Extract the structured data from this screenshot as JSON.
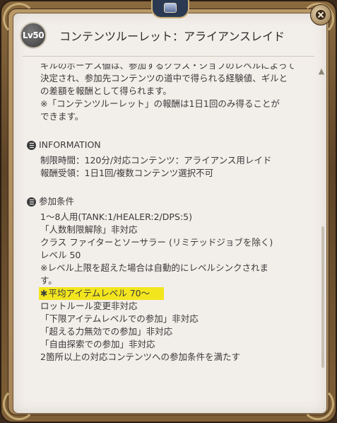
{
  "header": {
    "level_badge": "Lv50",
    "title": "コンテンツルーレット：アライアンスレイド"
  },
  "intro_lines": [
    "ギルのボーナス値は、参加するクラス・ジョブのレベルによって",
    "決定され、参加先コンテンツの道中で得られる経験値、ギルと",
    "の差額を報酬として得られます。",
    "※「コンテンツルーレット」の報酬は1日1回のみ得ることが",
    "できます。"
  ],
  "information": {
    "heading": "INFORMATION",
    "lines": [
      "制限時間：120分/対応コンテンツ：アライアンス用レイド",
      "報酬受領：1日1回/複数コンテンツ選択不可"
    ]
  },
  "conditions": {
    "heading": "参加条件",
    "lines_before": [
      "1〜8人用(TANK:1/HEALER:2/DPS:5)",
      "「人数制限解除」非対応",
      "クラス ファイターとソーサラー (リミテッドジョブを除く)",
      "レベル 50",
      "※レベル上限を超えた場合は自動的にレベルシンクされま",
      "す。"
    ],
    "highlight_icon": "✱",
    "highlight_line": "平均アイテムレベル 70〜",
    "lines_after": [
      "ロットルール変更非対応",
      "「下限アイテムレベルでの参加」非対応",
      "「超える力無効での参加」非対応",
      "「自由探索での参加」非対応",
      "2箇所以上の対応コンテンツへの参加条件を満たす"
    ]
  },
  "icons": {
    "close": "close-icon",
    "scroll_up": "chevron-up-icon",
    "section": "list-icon"
  },
  "colors": {
    "highlight": "#f2e51e",
    "paper": "#f2eeea",
    "frame": "#8a6a3e"
  }
}
